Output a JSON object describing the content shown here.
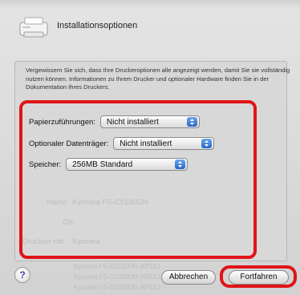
{
  "window": {
    "title": "Installationsoptionen"
  },
  "panel": {
    "description": "Vergewissern Sie sich, dass Ihre Druckeroptionen alle angezeigt werden, damit Sie sie vollständig nutzen können. Informationen zu Ihrem Drucker und optionaler Hardware finden Sie in der Dokumentation Ihres Druckers."
  },
  "options": [
    {
      "label": "Papierzuführungen:",
      "value": "Nicht installiert"
    },
    {
      "label": "Optionaler Datenträger:",
      "value": "Nicht installiert"
    },
    {
      "label": "Speicher:",
      "value": "256MB Standard"
    }
  ],
  "background": {
    "name_label": "Name:",
    "name_value": "Kyocera FS-C5100DN",
    "location_label": "Ort:",
    "driver_label": "Drucken mit:",
    "driver_value": "Kyocera",
    "list_items": [
      "Kyocera FS-C5100DN (KPDL)",
      "Kyocera FS-C5200DN (KPDL)",
      "Kyocera FS-C5300DN (KPDL)"
    ]
  },
  "buttons": {
    "help": "?",
    "cancel": "Abbrechen",
    "continue": "Fortfahren"
  },
  "colors": {
    "highlight": "#e01417",
    "popup_arrow": "#2767c9"
  }
}
